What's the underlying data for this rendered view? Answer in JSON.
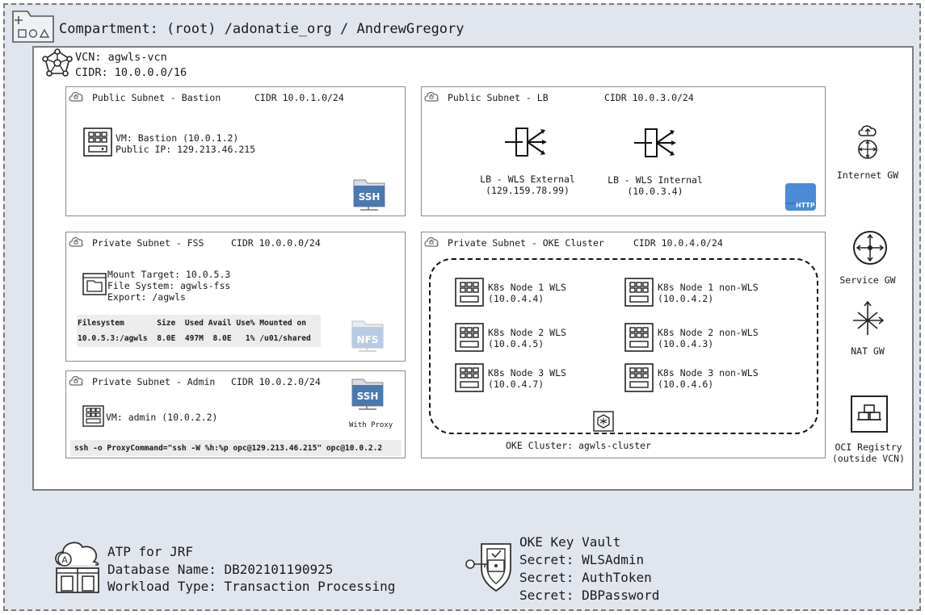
{
  "compartment": {
    "label": "Compartment: (root) /adonatie_org / AndrewGregory"
  },
  "vcn": {
    "name": "VCN: agwls-vcn",
    "cidr": "CIDR: 10.0.0.0/16"
  },
  "subnets": {
    "bastion": {
      "title": "Public Subnet - Bastion",
      "cidr": "CIDR 10.0.1.0/24",
      "vm_line1": "VM: Bastion (10.0.1.2)",
      "vm_line2": "Public IP: 129.213.46.215",
      "folder_label": "SSH"
    },
    "lb": {
      "title": "Public Subnet - LB",
      "cidr": "CIDR 10.0.3.0/24",
      "lb_external": "LB - WLS External",
      "lb_external_ip": "(129.159.78.99)",
      "lb_internal": "LB - WLS Internal",
      "lb_internal_ip": "(10.0.3.4)",
      "http_label": "HTTP"
    },
    "fss": {
      "title": "Private Subnet - FSS",
      "cidr": "CIDR 10.0.0.0/24",
      "mount_target": "Mount Target: 10.0.5.3",
      "file_system": "File System: agwls-fss",
      "export": "Export: /agwls",
      "df_header": "Filesystem       Size  Used Avail Use% Mounted on",
      "df_row": "10.0.5.3:/agwls  8.0E  497M  8.0E   1% /u01/shared",
      "folder_label": "NFS"
    },
    "admin": {
      "title": "Private Subnet - Admin",
      "cidr": "CIDR 10.0.2.0/24",
      "vm": "VM: admin (10.0.2.2)",
      "folder_label": "SSH",
      "proxy_note": "With Proxy",
      "ssh_command": "ssh -o ProxyCommand=\"ssh -W %h:%p opc@129.213.46.215\" opc@10.0.2.2"
    },
    "oke": {
      "title": "Private Subnet - OKE Cluster",
      "cidr": "CIDR 10.0.4.0/24",
      "cluster_label": "OKE Cluster: agwls-cluster",
      "nodes": [
        {
          "name": "K8s Node 1 WLS",
          "ip": "(10.0.4.4)"
        },
        {
          "name": "K8s Node 1 non-WLS",
          "ip": "(10.0.4.2)"
        },
        {
          "name": "K8s Node 2 WLS",
          "ip": "(10.0.4.5)"
        },
        {
          "name": "K8s Node 2 non-WLS",
          "ip": "(10.0.4.3)"
        },
        {
          "name": "K8s Node 3 WLS",
          "ip": "(10.0.4.7)"
        },
        {
          "name": "K8s Node 3 non-WLS",
          "ip": "(10.0.4.6)"
        }
      ]
    }
  },
  "gateways": {
    "internet": "Internet GW",
    "service": "Service GW",
    "nat": "NAT GW",
    "registry_line1": "OCI Registry",
    "registry_line2": "(outside VCN)"
  },
  "atp": {
    "line1": "ATP for JRF",
    "line2": "Database Name: DB202101190925",
    "line3": "Workload Type: Transaction Processing"
  },
  "vault": {
    "line1": "OKE Key Vault",
    "line2": "Secret: WLSAdmin",
    "line3": "Secret: AuthToken",
    "line4": "Secret: DBPassword"
  }
}
